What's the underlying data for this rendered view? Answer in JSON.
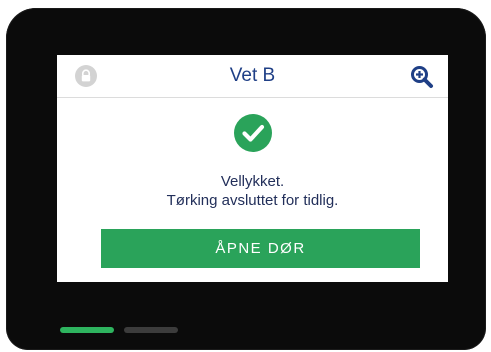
{
  "header": {
    "title": "Vet B",
    "left_icon": "lock-icon",
    "right_icon": "search-zoom-icon"
  },
  "status": {
    "icon": "success-check-icon",
    "line1": "Vellykket.",
    "line2": "Tørking avsluttet for tidlig."
  },
  "actions": {
    "open_door_label": "ÅPNE DØR"
  },
  "pagination": {
    "total_pages": 2,
    "active_page": 1
  },
  "colors": {
    "bezel": "#0b0b0b",
    "title_text": "#1f3f86",
    "success_green": "#2aa35a",
    "indicator_active": "#2eb45f",
    "indicator_inactive": "#3c3c3c",
    "lock_icon_gray": "#d0d0d0"
  }
}
